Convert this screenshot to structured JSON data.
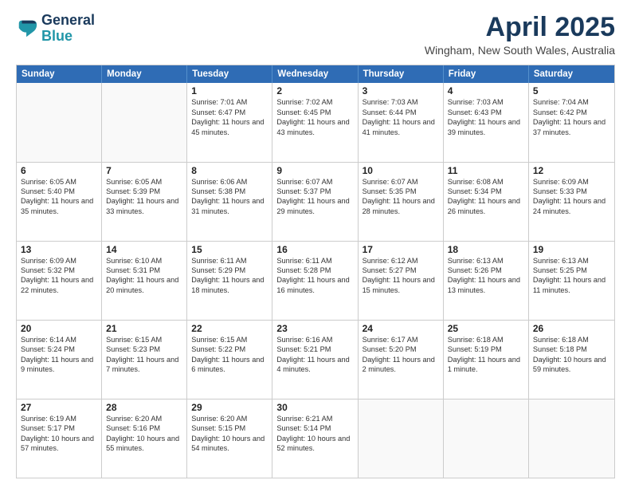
{
  "logo": {
    "line1": "General",
    "line2": "Blue"
  },
  "title": "April 2025",
  "subtitle": "Wingham, New South Wales, Australia",
  "days_of_week": [
    "Sunday",
    "Monday",
    "Tuesday",
    "Wednesday",
    "Thursday",
    "Friday",
    "Saturday"
  ],
  "weeks": [
    [
      {
        "day": "",
        "empty": true
      },
      {
        "day": "",
        "empty": true
      },
      {
        "day": "1",
        "sunrise": "Sunrise: 7:01 AM",
        "sunset": "Sunset: 6:47 PM",
        "daylight": "Daylight: 11 hours and 45 minutes."
      },
      {
        "day": "2",
        "sunrise": "Sunrise: 7:02 AM",
        "sunset": "Sunset: 6:45 PM",
        "daylight": "Daylight: 11 hours and 43 minutes."
      },
      {
        "day": "3",
        "sunrise": "Sunrise: 7:03 AM",
        "sunset": "Sunset: 6:44 PM",
        "daylight": "Daylight: 11 hours and 41 minutes."
      },
      {
        "day": "4",
        "sunrise": "Sunrise: 7:03 AM",
        "sunset": "Sunset: 6:43 PM",
        "daylight": "Daylight: 11 hours and 39 minutes."
      },
      {
        "day": "5",
        "sunrise": "Sunrise: 7:04 AM",
        "sunset": "Sunset: 6:42 PM",
        "daylight": "Daylight: 11 hours and 37 minutes."
      }
    ],
    [
      {
        "day": "6",
        "sunrise": "Sunrise: 6:05 AM",
        "sunset": "Sunset: 5:40 PM",
        "daylight": "Daylight: 11 hours and 35 minutes."
      },
      {
        "day": "7",
        "sunrise": "Sunrise: 6:05 AM",
        "sunset": "Sunset: 5:39 PM",
        "daylight": "Daylight: 11 hours and 33 minutes."
      },
      {
        "day": "8",
        "sunrise": "Sunrise: 6:06 AM",
        "sunset": "Sunset: 5:38 PM",
        "daylight": "Daylight: 11 hours and 31 minutes."
      },
      {
        "day": "9",
        "sunrise": "Sunrise: 6:07 AM",
        "sunset": "Sunset: 5:37 PM",
        "daylight": "Daylight: 11 hours and 29 minutes."
      },
      {
        "day": "10",
        "sunrise": "Sunrise: 6:07 AM",
        "sunset": "Sunset: 5:35 PM",
        "daylight": "Daylight: 11 hours and 28 minutes."
      },
      {
        "day": "11",
        "sunrise": "Sunrise: 6:08 AM",
        "sunset": "Sunset: 5:34 PM",
        "daylight": "Daylight: 11 hours and 26 minutes."
      },
      {
        "day": "12",
        "sunrise": "Sunrise: 6:09 AM",
        "sunset": "Sunset: 5:33 PM",
        "daylight": "Daylight: 11 hours and 24 minutes."
      }
    ],
    [
      {
        "day": "13",
        "sunrise": "Sunrise: 6:09 AM",
        "sunset": "Sunset: 5:32 PM",
        "daylight": "Daylight: 11 hours and 22 minutes."
      },
      {
        "day": "14",
        "sunrise": "Sunrise: 6:10 AM",
        "sunset": "Sunset: 5:31 PM",
        "daylight": "Daylight: 11 hours and 20 minutes."
      },
      {
        "day": "15",
        "sunrise": "Sunrise: 6:11 AM",
        "sunset": "Sunset: 5:29 PM",
        "daylight": "Daylight: 11 hours and 18 minutes."
      },
      {
        "day": "16",
        "sunrise": "Sunrise: 6:11 AM",
        "sunset": "Sunset: 5:28 PM",
        "daylight": "Daylight: 11 hours and 16 minutes."
      },
      {
        "day": "17",
        "sunrise": "Sunrise: 6:12 AM",
        "sunset": "Sunset: 5:27 PM",
        "daylight": "Daylight: 11 hours and 15 minutes."
      },
      {
        "day": "18",
        "sunrise": "Sunrise: 6:13 AM",
        "sunset": "Sunset: 5:26 PM",
        "daylight": "Daylight: 11 hours and 13 minutes."
      },
      {
        "day": "19",
        "sunrise": "Sunrise: 6:13 AM",
        "sunset": "Sunset: 5:25 PM",
        "daylight": "Daylight: 11 hours and 11 minutes."
      }
    ],
    [
      {
        "day": "20",
        "sunrise": "Sunrise: 6:14 AM",
        "sunset": "Sunset: 5:24 PM",
        "daylight": "Daylight: 11 hours and 9 minutes."
      },
      {
        "day": "21",
        "sunrise": "Sunrise: 6:15 AM",
        "sunset": "Sunset: 5:23 PM",
        "daylight": "Daylight: 11 hours and 7 minutes."
      },
      {
        "day": "22",
        "sunrise": "Sunrise: 6:15 AM",
        "sunset": "Sunset: 5:22 PM",
        "daylight": "Daylight: 11 hours and 6 minutes."
      },
      {
        "day": "23",
        "sunrise": "Sunrise: 6:16 AM",
        "sunset": "Sunset: 5:21 PM",
        "daylight": "Daylight: 11 hours and 4 minutes."
      },
      {
        "day": "24",
        "sunrise": "Sunrise: 6:17 AM",
        "sunset": "Sunset: 5:20 PM",
        "daylight": "Daylight: 11 hours and 2 minutes."
      },
      {
        "day": "25",
        "sunrise": "Sunrise: 6:18 AM",
        "sunset": "Sunset: 5:19 PM",
        "daylight": "Daylight: 11 hours and 1 minute."
      },
      {
        "day": "26",
        "sunrise": "Sunrise: 6:18 AM",
        "sunset": "Sunset: 5:18 PM",
        "daylight": "Daylight: 10 hours and 59 minutes."
      }
    ],
    [
      {
        "day": "27",
        "sunrise": "Sunrise: 6:19 AM",
        "sunset": "Sunset: 5:17 PM",
        "daylight": "Daylight: 10 hours and 57 minutes."
      },
      {
        "day": "28",
        "sunrise": "Sunrise: 6:20 AM",
        "sunset": "Sunset: 5:16 PM",
        "daylight": "Daylight: 10 hours and 55 minutes."
      },
      {
        "day": "29",
        "sunrise": "Sunrise: 6:20 AM",
        "sunset": "Sunset: 5:15 PM",
        "daylight": "Daylight: 10 hours and 54 minutes."
      },
      {
        "day": "30",
        "sunrise": "Sunrise: 6:21 AM",
        "sunset": "Sunset: 5:14 PM",
        "daylight": "Daylight: 10 hours and 52 minutes."
      },
      {
        "day": "",
        "empty": true
      },
      {
        "day": "",
        "empty": true
      },
      {
        "day": "",
        "empty": true
      }
    ]
  ]
}
